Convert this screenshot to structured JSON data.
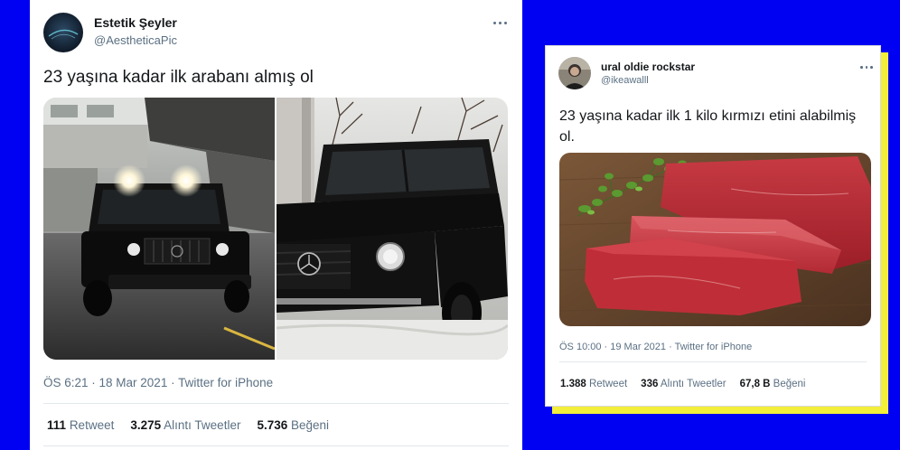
{
  "colors": {
    "background": "#0000f2",
    "accent_shadow": "#f2ee3a",
    "card": "#ffffff",
    "text_primary": "#14171a",
    "text_secondary": "#5b7083",
    "divider": "#e1e8ed"
  },
  "tweets": [
    {
      "display_name": "Estetik Şeyler",
      "handle": "@AestheticaPic",
      "menu_icon": "more-icon",
      "text": "23 yaşına kadar ilk arabanı almış ol",
      "timestamp": "ÖS 6:21 · 18 Mar 2021 · Twitter for iPhone",
      "stats": [
        {
          "count": "111",
          "label": "Retweet"
        },
        {
          "count": "3.275",
          "label": "Alıntı Tweetler"
        },
        {
          "count": "5.736",
          "label": "Beğeni"
        }
      ]
    },
    {
      "display_name": "ural oldie rockstar",
      "handle": "@ikeawalll",
      "menu_icon": "more-icon",
      "text": "23 yaşına kadar ilk 1 kilo kırmızı etini alabilmiş ol.",
      "timestamp": "ÖS 10:00 · 19 Mar 2021 · Twitter for iPhone",
      "stats": [
        {
          "count": "1.388",
          "label": "Retweet"
        },
        {
          "count": "336",
          "label": "Alıntı Tweetler"
        },
        {
          "count": "67,8 B",
          "label": "Beğeni"
        }
      ]
    }
  ]
}
